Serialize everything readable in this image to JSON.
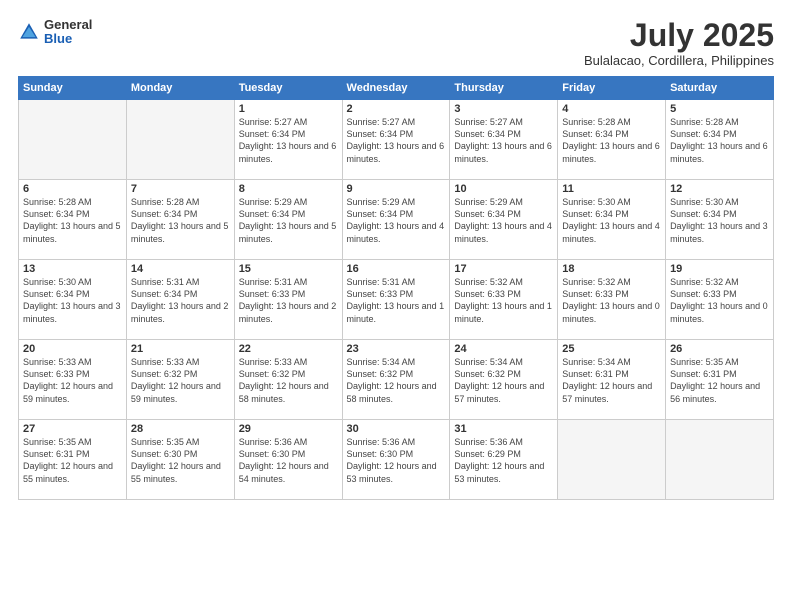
{
  "header": {
    "logo": {
      "general": "General",
      "blue": "Blue"
    },
    "title": "July 2025",
    "location": "Bulalacao, Cordillera, Philippines"
  },
  "weekdays": [
    "Sunday",
    "Monday",
    "Tuesday",
    "Wednesday",
    "Thursday",
    "Friday",
    "Saturday"
  ],
  "weeks": [
    [
      {
        "day": "",
        "info": ""
      },
      {
        "day": "",
        "info": ""
      },
      {
        "day": "1",
        "info": "Sunrise: 5:27 AM\nSunset: 6:34 PM\nDaylight: 13 hours\nand 6 minutes."
      },
      {
        "day": "2",
        "info": "Sunrise: 5:27 AM\nSunset: 6:34 PM\nDaylight: 13 hours\nand 6 minutes."
      },
      {
        "day": "3",
        "info": "Sunrise: 5:27 AM\nSunset: 6:34 PM\nDaylight: 13 hours\nand 6 minutes."
      },
      {
        "day": "4",
        "info": "Sunrise: 5:28 AM\nSunset: 6:34 PM\nDaylight: 13 hours\nand 6 minutes."
      },
      {
        "day": "5",
        "info": "Sunrise: 5:28 AM\nSunset: 6:34 PM\nDaylight: 13 hours\nand 6 minutes."
      }
    ],
    [
      {
        "day": "6",
        "info": "Sunrise: 5:28 AM\nSunset: 6:34 PM\nDaylight: 13 hours\nand 5 minutes."
      },
      {
        "day": "7",
        "info": "Sunrise: 5:28 AM\nSunset: 6:34 PM\nDaylight: 13 hours\nand 5 minutes."
      },
      {
        "day": "8",
        "info": "Sunrise: 5:29 AM\nSunset: 6:34 PM\nDaylight: 13 hours\nand 5 minutes."
      },
      {
        "day": "9",
        "info": "Sunrise: 5:29 AM\nSunset: 6:34 PM\nDaylight: 13 hours\nand 4 minutes."
      },
      {
        "day": "10",
        "info": "Sunrise: 5:29 AM\nSunset: 6:34 PM\nDaylight: 13 hours\nand 4 minutes."
      },
      {
        "day": "11",
        "info": "Sunrise: 5:30 AM\nSunset: 6:34 PM\nDaylight: 13 hours\nand 4 minutes."
      },
      {
        "day": "12",
        "info": "Sunrise: 5:30 AM\nSunset: 6:34 PM\nDaylight: 13 hours\nand 3 minutes."
      }
    ],
    [
      {
        "day": "13",
        "info": "Sunrise: 5:30 AM\nSunset: 6:34 PM\nDaylight: 13 hours\nand 3 minutes."
      },
      {
        "day": "14",
        "info": "Sunrise: 5:31 AM\nSunset: 6:34 PM\nDaylight: 13 hours\nand 2 minutes."
      },
      {
        "day": "15",
        "info": "Sunrise: 5:31 AM\nSunset: 6:33 PM\nDaylight: 13 hours\nand 2 minutes."
      },
      {
        "day": "16",
        "info": "Sunrise: 5:31 AM\nSunset: 6:33 PM\nDaylight: 13 hours\nand 1 minute."
      },
      {
        "day": "17",
        "info": "Sunrise: 5:32 AM\nSunset: 6:33 PM\nDaylight: 13 hours\nand 1 minute."
      },
      {
        "day": "18",
        "info": "Sunrise: 5:32 AM\nSunset: 6:33 PM\nDaylight: 13 hours\nand 0 minutes."
      },
      {
        "day": "19",
        "info": "Sunrise: 5:32 AM\nSunset: 6:33 PM\nDaylight: 13 hours\nand 0 minutes."
      }
    ],
    [
      {
        "day": "20",
        "info": "Sunrise: 5:33 AM\nSunset: 6:33 PM\nDaylight: 12 hours\nand 59 minutes."
      },
      {
        "day": "21",
        "info": "Sunrise: 5:33 AM\nSunset: 6:32 PM\nDaylight: 12 hours\nand 59 minutes."
      },
      {
        "day": "22",
        "info": "Sunrise: 5:33 AM\nSunset: 6:32 PM\nDaylight: 12 hours\nand 58 minutes."
      },
      {
        "day": "23",
        "info": "Sunrise: 5:34 AM\nSunset: 6:32 PM\nDaylight: 12 hours\nand 58 minutes."
      },
      {
        "day": "24",
        "info": "Sunrise: 5:34 AM\nSunset: 6:32 PM\nDaylight: 12 hours\nand 57 minutes."
      },
      {
        "day": "25",
        "info": "Sunrise: 5:34 AM\nSunset: 6:31 PM\nDaylight: 12 hours\nand 57 minutes."
      },
      {
        "day": "26",
        "info": "Sunrise: 5:35 AM\nSunset: 6:31 PM\nDaylight: 12 hours\nand 56 minutes."
      }
    ],
    [
      {
        "day": "27",
        "info": "Sunrise: 5:35 AM\nSunset: 6:31 PM\nDaylight: 12 hours\nand 55 minutes."
      },
      {
        "day": "28",
        "info": "Sunrise: 5:35 AM\nSunset: 6:30 PM\nDaylight: 12 hours\nand 55 minutes."
      },
      {
        "day": "29",
        "info": "Sunrise: 5:36 AM\nSunset: 6:30 PM\nDaylight: 12 hours\nand 54 minutes."
      },
      {
        "day": "30",
        "info": "Sunrise: 5:36 AM\nSunset: 6:30 PM\nDaylight: 12 hours\nand 53 minutes."
      },
      {
        "day": "31",
        "info": "Sunrise: 5:36 AM\nSunset: 6:29 PM\nDaylight: 12 hours\nand 53 minutes."
      },
      {
        "day": "",
        "info": ""
      },
      {
        "day": "",
        "info": ""
      }
    ]
  ]
}
